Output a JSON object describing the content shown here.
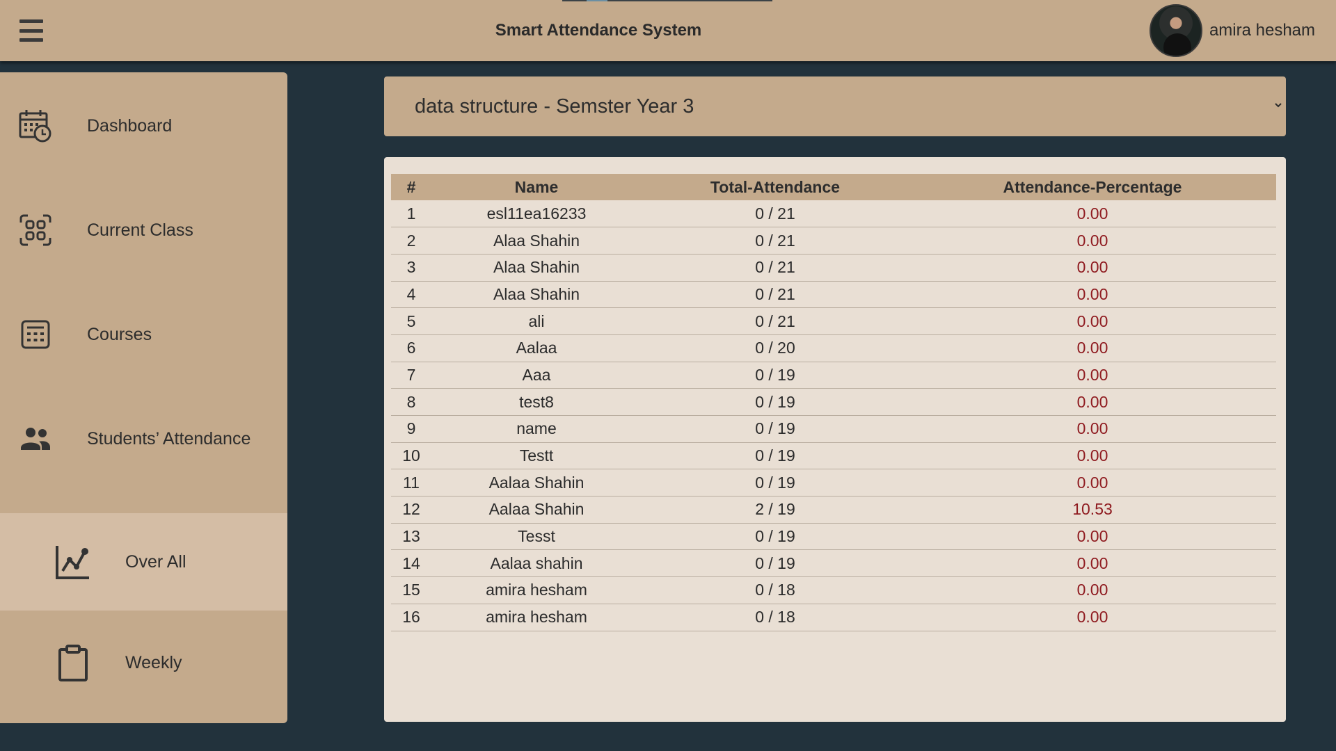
{
  "app": {
    "title": "Smart Attendance System"
  },
  "user": {
    "name": "amira hesham"
  },
  "sidebar": {
    "items": [
      {
        "label": "Dashboard",
        "icon": "calendar-clock-icon"
      },
      {
        "label": "Current Class",
        "icon": "scan-icon"
      },
      {
        "label": "Courses",
        "icon": "calculator-icon"
      },
      {
        "label": "Students’ Attendance",
        "icon": "people-icon"
      }
    ],
    "subitems": [
      {
        "label": "Over All",
        "icon": "chart-line-icon",
        "active": true
      },
      {
        "label": "Weekly",
        "icon": "clipboard-icon",
        "active": false
      }
    ]
  },
  "course_select": {
    "value": "data structure - Semster Year 3"
  },
  "table": {
    "headers": [
      "#",
      "Name",
      "Total-Attendance",
      "Attendance-Percentage"
    ],
    "rows": [
      [
        "1",
        "esl11ea16233",
        "0 / 21",
        "0.00"
      ],
      [
        "2",
        "Alaa Shahin",
        "0 / 21",
        "0.00"
      ],
      [
        "3",
        "Alaa Shahin",
        "0 / 21",
        "0.00"
      ],
      [
        "4",
        "Alaa Shahin",
        "0 / 21",
        "0.00"
      ],
      [
        "5",
        "ali",
        "0 / 21",
        "0.00"
      ],
      [
        "6",
        "Aalaa",
        "0 / 20",
        "0.00"
      ],
      [
        "7",
        "Aaa",
        "0 / 19",
        "0.00"
      ],
      [
        "8",
        "test8",
        "0 / 19",
        "0.00"
      ],
      [
        "9",
        "name",
        "0 / 19",
        "0.00"
      ],
      [
        "10",
        "Testt",
        "0 / 19",
        "0.00"
      ],
      [
        "11",
        "Aalaa Shahin",
        "0 / 19",
        "0.00"
      ],
      [
        "12",
        "Aalaa Shahin",
        "2 / 19",
        "10.53"
      ],
      [
        "13",
        "Tesst",
        "0 / 19",
        "0.00"
      ],
      [
        "14",
        "Aalaa shahin",
        "0 / 19",
        "0.00"
      ],
      [
        "15",
        "amira hesham",
        "0 / 18",
        "0.00"
      ],
      [
        "16",
        "amira hesham",
        "0 / 18",
        "0.00"
      ]
    ]
  },
  "colors": {
    "topbar": "#c4aa8c",
    "background": "#22323c",
    "card": "#e9dfd4",
    "active_subitem": "#d4bda5",
    "percentage_text": "#8f1b20"
  }
}
